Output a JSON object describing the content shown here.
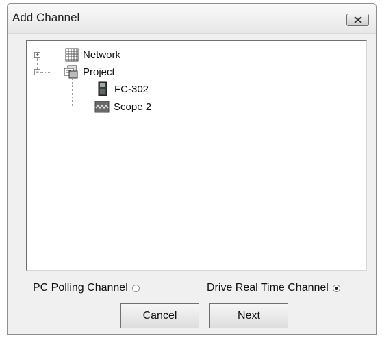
{
  "window": {
    "title": "Add Channel"
  },
  "tree": {
    "network": {
      "label": "Network",
      "expander": "+"
    },
    "project": {
      "label": "Project",
      "expander": "−",
      "children": [
        {
          "label": "FC-302"
        },
        {
          "label": "Scope 2"
        }
      ]
    }
  },
  "options": {
    "pc_polling": {
      "label": "PC Polling Channel",
      "selected": false
    },
    "drive_realtime": {
      "label": "Drive Real Time Channel",
      "selected": true
    }
  },
  "buttons": {
    "cancel": "Cancel",
    "next": "Next"
  }
}
